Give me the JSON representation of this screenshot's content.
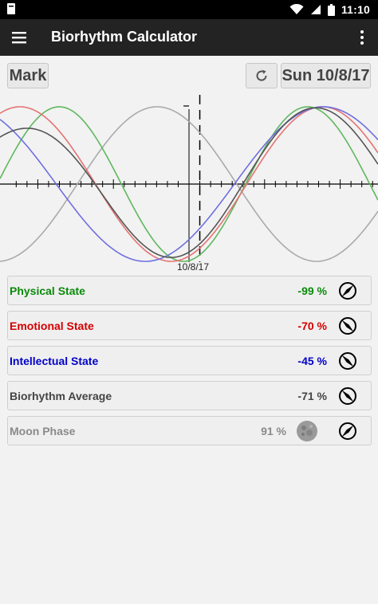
{
  "status_bar": {
    "time": "11:10",
    "icons": [
      "notification-icon",
      "wifi-icon",
      "cell-signal-icon",
      "battery-icon"
    ]
  },
  "app_bar": {
    "title": "Biorhythm Calculator",
    "menu_icon": "hamburger-menu-icon",
    "overflow_icon": "overflow-menu-icon"
  },
  "controls": {
    "mark_label": "Mark",
    "reset_icon": "reset-icon",
    "date_label": "Sun 10/8/17"
  },
  "chart_data": {
    "type": "line",
    "x_unit": "days relative to selected date",
    "x_range": [
      -16,
      19
    ],
    "ylim": [
      -100,
      100
    ],
    "current_date_label": "10/8/17",
    "series": [
      {
        "key": "physical",
        "period_days": 23,
        "current_percent": -99,
        "color": "#5fb85f"
      },
      {
        "key": "emotional",
        "period_days": 28,
        "current_percent": -70,
        "color": "#e57373"
      },
      {
        "key": "intellectual",
        "period_days": 33,
        "current_percent": -45,
        "color": "#6f6fe0"
      },
      {
        "key": "average",
        "current_percent": -71,
        "color": "#555555"
      },
      {
        "key": "moon",
        "period_days": 29.53,
        "current_percent": 91,
        "color": "#aaaaaa"
      }
    ]
  },
  "states": [
    {
      "label": "Physical State",
      "value": "-99 %",
      "color": "#0a8a0a",
      "icon": "compass-toggle-icon",
      "icon_angle": 45
    },
    {
      "label": "Emotional State",
      "value": "-70 %",
      "color": "#d40000",
      "icon": "compass-toggle-icon",
      "icon_angle": -45
    },
    {
      "label": "Intellectual State",
      "value": "-45 %",
      "color": "#0000c8",
      "icon": "compass-toggle-icon",
      "icon_angle": -45
    },
    {
      "label": "Biorhythm Average",
      "value": "-71 %",
      "color": "#444444",
      "icon": "compass-toggle-icon",
      "icon_angle": -45
    },
    {
      "label": "Moon Phase",
      "value": "91 %",
      "color": "#8a8a8a",
      "icon": "compass-toggle-icon",
      "icon_angle": 45,
      "moon_icon": "moon-phase-icon"
    }
  ]
}
